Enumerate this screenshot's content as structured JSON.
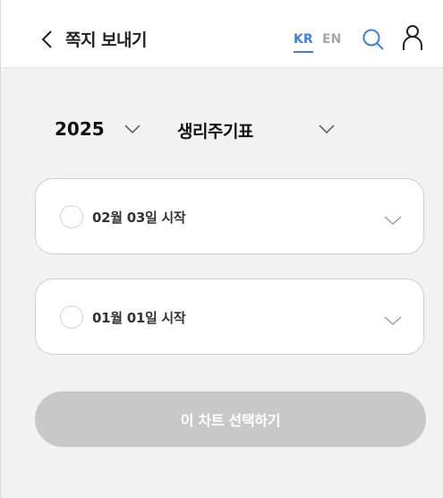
{
  "header": {
    "title": "쪽지 보내기",
    "languages": {
      "kr": "KR",
      "en": "EN",
      "active": "KR"
    },
    "icons": {
      "back": "chevron-left-icon",
      "search": "search-icon",
      "user": "user-icon"
    },
    "accent_color": "#3d7fe0"
  },
  "filters": {
    "year": "2025",
    "chart_type": "생리주기표"
  },
  "options": [
    {
      "label": "02월 03일 시작",
      "selected": false
    },
    {
      "label": "01월 01일 시작",
      "selected": false
    }
  ],
  "action": {
    "select_label": "이 차트 선택하기",
    "enabled": false
  }
}
